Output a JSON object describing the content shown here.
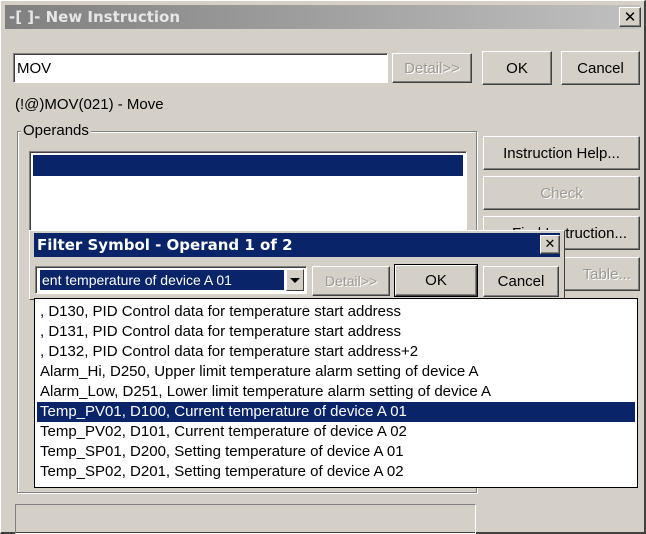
{
  "main_window": {
    "title": "-[ ]- New Instruction",
    "close_glyph": "✕",
    "instruction_input": {
      "value": "MOV"
    },
    "detail_button": "Detail>>",
    "ok_button": "OK",
    "cancel_button": "Cancel",
    "description": "(!@)MOV(021) - Move",
    "operands_label": "Operands",
    "side_buttons": {
      "instruction_help": "Instruction Help...",
      "check": "Check",
      "find_instruction_partial": "Find Instruction...",
      "table_partial": "Table..."
    }
  },
  "filter_dialog": {
    "title": "Filter Symbol - Operand 1 of 2",
    "close_glyph": "✕",
    "combo_value": "ent temperature of device A 01",
    "detail_button": "Detail>>",
    "ok_button": "OK",
    "cancel_button": "Cancel"
  },
  "dropdown_items": [
    ", D130,  PID Control data for temperature start address",
    ", D131,  PID Control data for temperature start address",
    ", D132,  PID Control data for temperature start address+2",
    "Alarm_Hi,  D250,  Upper limit temperature alarm setting of  device A",
    "Alarm_Low,  D251,  Lower limit temperature alarm setting of  device A",
    "Temp_PV01,  D100,  Current temperature of device A 01",
    "Temp_PV02,  D101,  Current temperature of device A 02",
    "Temp_SP01,  D200,  Setting temperature of device A 01",
    "Temp_SP02,  D201,  Setting temperature of device A 02"
  ],
  "selected_item_index": 5,
  "colors": {
    "face": "#d4d0c8",
    "selection": "#0a246a",
    "inactive_title": "#808080",
    "active_title": "#0a246a"
  }
}
